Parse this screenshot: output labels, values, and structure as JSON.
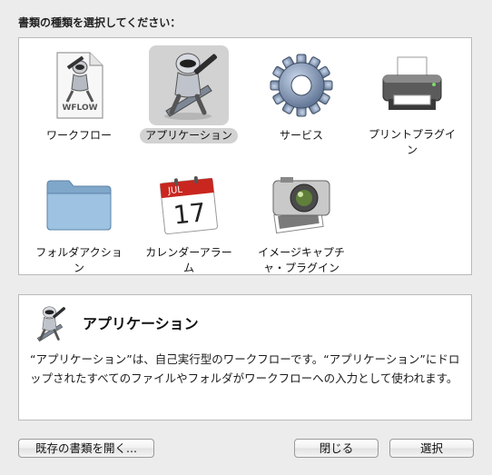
{
  "prompt": "書類の種類を選択してください：",
  "items": [
    {
      "label": "ワークフロー",
      "icon": "workflow-document-icon",
      "selected": false
    },
    {
      "label": "アプリケーション",
      "icon": "automator-robot-icon",
      "selected": true
    },
    {
      "label": "サービス",
      "icon": "gear-icon",
      "selected": false
    },
    {
      "label": "プリントプラグイン",
      "icon": "printer-icon",
      "selected": false
    },
    {
      "label": "フォルダアクション",
      "icon": "folder-icon",
      "selected": false
    },
    {
      "label": "カレンダーアラーム",
      "icon": "calendar-icon",
      "selected": false
    },
    {
      "label": "イメージキャプチャ・プラグイン",
      "icon": "camera-icon",
      "selected": false
    }
  ],
  "workflow_icon_text": "WFLOW",
  "calendar_month": "JUL",
  "calendar_day": "17",
  "description": {
    "title": "アプリケーション",
    "text": "“アプリケーション”は、自己実行型のワークフローです。“アプリケーション”にドロップされたすべてのファイルやフォルダがワークフローへの入力として使われます。",
    "icon": "automator-robot-icon"
  },
  "buttons": {
    "open_existing": "既存の書類を開く...",
    "close": "閉じる",
    "choose": "選択"
  }
}
